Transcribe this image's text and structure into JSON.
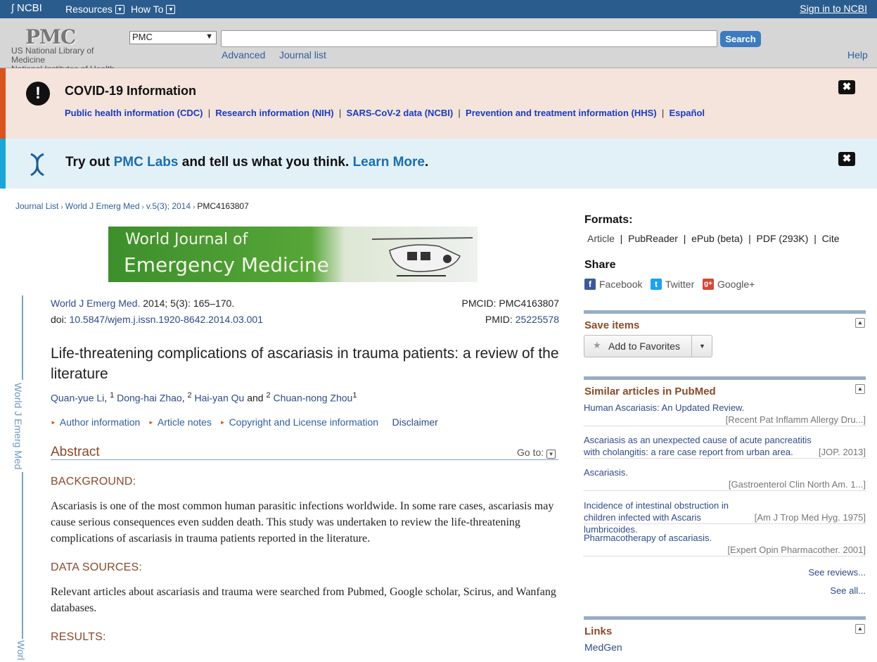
{
  "topbar": {
    "ncbi": "NCBI",
    "resources": "Resources",
    "howto": "How To",
    "signin": "Sign in to NCBI"
  },
  "header": {
    "pmc_logo": "PMC",
    "nlm_line1": "US National Library of",
    "nlm_line2": "Medicine",
    "nih_line": "National Institutes of Health",
    "db_selected": "PMC",
    "search_value": "",
    "search_button": "Search",
    "advanced": "Advanced",
    "journal_list": "Journal list",
    "help": "Help"
  },
  "covid": {
    "title": "COVID-19 Information",
    "links": [
      "Public health information (CDC)",
      "Research information (NIH)",
      "SARS-CoV-2 data (NCBI)",
      "Prevention and treatment information (HHS)",
      "Español"
    ],
    "separator": "|"
  },
  "labs": {
    "pre": "Try out ",
    "link1": "PMC Labs",
    "mid": " and tell us what you think. ",
    "link2": "Learn More",
    "post": "."
  },
  "breadcrumb": [
    "Journal List",
    "World J Emerg Med",
    "v.5(3); 2014",
    "PMC4163807"
  ],
  "journal_banner": {
    "line1": "World Journal of",
    "line2": "Emergency Medicine"
  },
  "sidebar_journal": "World J Emerg Med",
  "sidebar_journal_tail": "Worl",
  "article": {
    "journal_link": "World J Emerg Med.",
    "citation": " 2014; 5(3): 165–170.",
    "doi_label": "doi: ",
    "doi": "10.5847/wjem.j.issn.1920-8642.2014.03.001",
    "pmcid": "PMCID: PMC4163807",
    "pmid_label": "PMID: ",
    "pmid": "25225578",
    "title": "Life-threatening complications of ascariasis in trauma patients: a review of the literature",
    "authors": [
      {
        "name": "Quan-yue Li",
        "sup": "1",
        "after": ", "
      },
      {
        "name": "Dong-hai Zhao",
        "sup": "2",
        "after": ", "
      },
      {
        "name": "Hai-yan Qu",
        "sup": "2",
        "after": " and "
      },
      {
        "name": "Chuan-nong Zhou",
        "sup": "1",
        "after": ""
      }
    ],
    "info_links": [
      "Author information",
      "Article notes",
      "Copyright and License information"
    ],
    "disclaimer": "Disclaimer",
    "abstract_heading": "Abstract",
    "goto": "Go to:",
    "sections": [
      {
        "heading": "BACKGROUND:",
        "text": "Ascariasis is one of the most common human parasitic infections worldwide. In some rare cases, ascariasis may cause serious consequences even sudden death. This study was undertaken to review the life-threatening complications of ascariasis in trauma patients reported in the literature."
      },
      {
        "heading": "DATA SOURCES:",
        "text": "Relevant articles about ascariasis and trauma were searched from Pubmed, Google scholar, Scirus, and Wanfang databases."
      },
      {
        "heading": "RESULTS:",
        "text": ""
      }
    ]
  },
  "right": {
    "formats_title": "Formats:",
    "formats": [
      "Article",
      "PubReader",
      "ePub (beta)",
      "PDF (293K)",
      "Cite"
    ],
    "share_title": "Share",
    "share": [
      "Facebook",
      "Twitter",
      "Google+"
    ],
    "save_title": "Save items",
    "add_favorites": "Add to Favorites",
    "similar_title": "Similar articles in PubMed",
    "similar": [
      {
        "title": "Human Ascariasis: An Updated Review.",
        "journal": "[Recent Pat Inflamm Allergy Dru...]"
      },
      {
        "title": "Ascariasis as an unexpected cause of acute pancreatitis with cholangitis: a rare case report from urban area.",
        "journal": "[JOP. 2013]"
      },
      {
        "title": "Ascariasis.",
        "journal": "[Gastroenterol Clin North Am. 1...]"
      },
      {
        "title": "Incidence of intestinal obstruction in children infected with Ascaris lumbricoides.",
        "journal": "[Am J Trop Med Hyg. 1975]"
      },
      {
        "title": "Pharmacotherapy of ascariasis.",
        "journal": "[Expert Opin Pharmacother. 2001]"
      }
    ],
    "see_reviews": "See reviews...",
    "see_all": "See all...",
    "links_title": "Links",
    "medgen": "MedGen"
  }
}
